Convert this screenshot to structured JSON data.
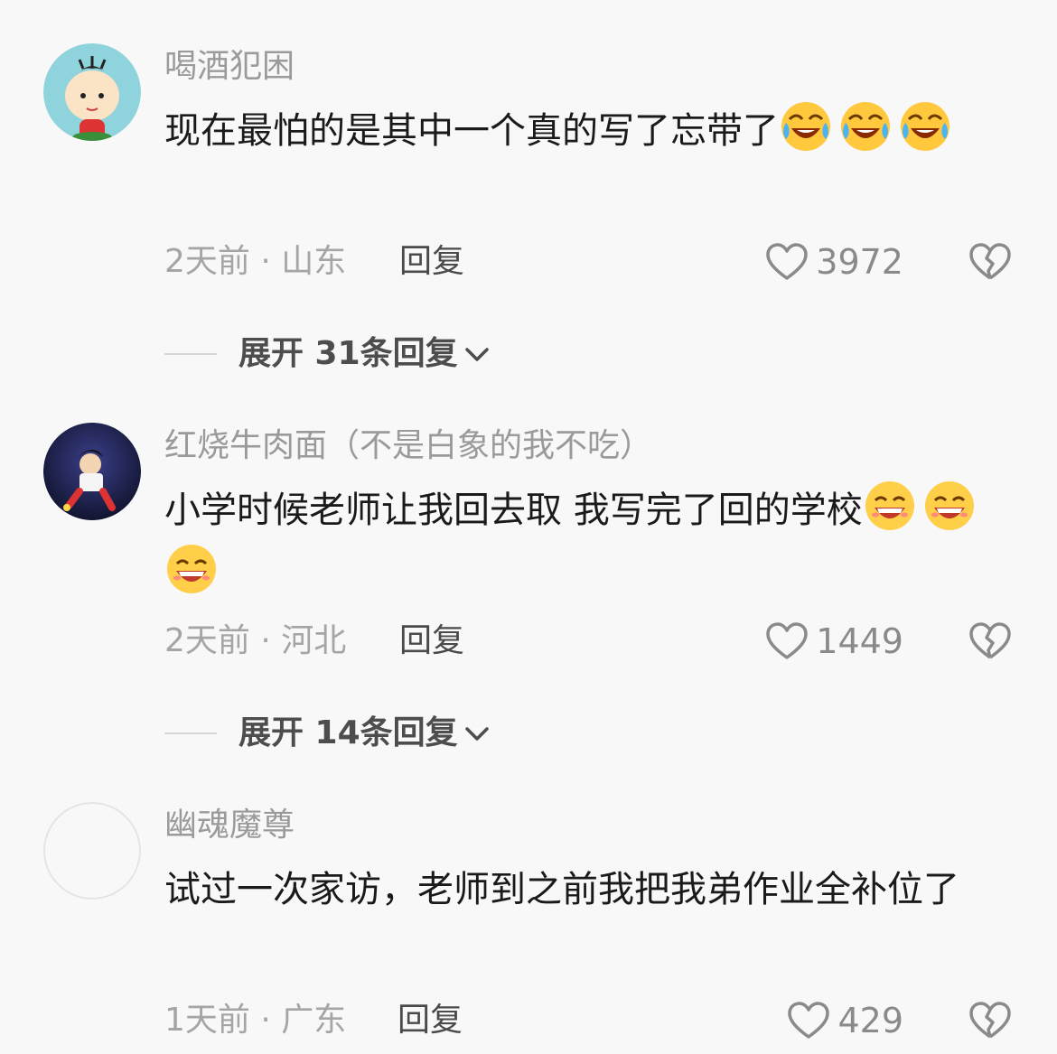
{
  "comments": [
    {
      "username": "喝酒犯困",
      "text": "现在最怕的是其中一个真的写了忘带了",
      "emojis": [
        "laugh-cry",
        "laugh-cry",
        "laugh-cry"
      ],
      "time_location": "2天前 · 山东",
      "reply_label": "回复",
      "likes": "3972",
      "expand_label": "展开 31条回复"
    },
    {
      "username": "红烧牛肉面（不是白象的我不吃）",
      "text": "小学时候老师让我回去取 我写完了回的学校",
      "emojis": [
        "grin-sweat",
        "grin-sweat",
        "grin-sweat"
      ],
      "time_location": "2天前 · 河北",
      "reply_label": "回复",
      "likes": "1449",
      "expand_label": "展开 14条回复"
    },
    {
      "username": "幽魂魔尊",
      "text": "试过一次家访，老师到之前我把我弟作业全补位了",
      "emojis": [],
      "time_location": "1天前 · 广东",
      "reply_label": "回复",
      "likes": "429"
    }
  ],
  "icons": {
    "like": "heart-outline-icon",
    "dislike": "broken-heart-icon",
    "expand": "chevron-down-icon"
  }
}
